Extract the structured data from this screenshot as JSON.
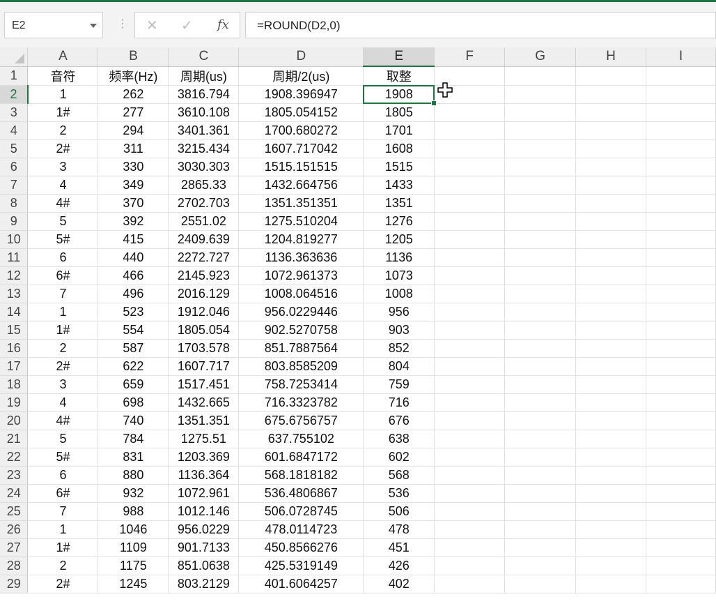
{
  "name_box": "E2",
  "formula": "=ROUND(D2,0)",
  "fx_label": "fx",
  "columns": [
    "A",
    "B",
    "C",
    "D",
    "E",
    "F",
    "G",
    "H",
    "I"
  ],
  "selected_cell": {
    "column": "E",
    "row": 2
  },
  "rows": [
    {
      "n": "1",
      "a": "音符",
      "b": "频率(Hz)",
      "c": "周期(us)",
      "d": "周期/2(us)",
      "e": "取整"
    },
    {
      "n": "2",
      "a": "1",
      "b": "262",
      "c": "3816.794",
      "d": "1908.396947",
      "e": "1908"
    },
    {
      "n": "3",
      "a": "1#",
      "b": "277",
      "c": "3610.108",
      "d": "1805.054152",
      "e": "1805"
    },
    {
      "n": "4",
      "a": "2",
      "b": "294",
      "c": "3401.361",
      "d": "1700.680272",
      "e": "1701"
    },
    {
      "n": "5",
      "a": "2#",
      "b": "311",
      "c": "3215.434",
      "d": "1607.717042",
      "e": "1608"
    },
    {
      "n": "6",
      "a": "3",
      "b": "330",
      "c": "3030.303",
      "d": "1515.151515",
      "e": "1515"
    },
    {
      "n": "7",
      "a": "4",
      "b": "349",
      "c": "2865.33",
      "d": "1432.664756",
      "e": "1433"
    },
    {
      "n": "8",
      "a": "4#",
      "b": "370",
      "c": "2702.703",
      "d": "1351.351351",
      "e": "1351"
    },
    {
      "n": "9",
      "a": "5",
      "b": "392",
      "c": "2551.02",
      "d": "1275.510204",
      "e": "1276"
    },
    {
      "n": "10",
      "a": "5#",
      "b": "415",
      "c": "2409.639",
      "d": "1204.819277",
      "e": "1205"
    },
    {
      "n": "11",
      "a": "6",
      "b": "440",
      "c": "2272.727",
      "d": "1136.363636",
      "e": "1136"
    },
    {
      "n": "12",
      "a": "6#",
      "b": "466",
      "c": "2145.923",
      "d": "1072.961373",
      "e": "1073"
    },
    {
      "n": "13",
      "a": "7",
      "b": "496",
      "c": "2016.129",
      "d": "1008.064516",
      "e": "1008"
    },
    {
      "n": "14",
      "a": "1",
      "b": "523",
      "c": "1912.046",
      "d": "956.0229446",
      "e": "956"
    },
    {
      "n": "15",
      "a": "1#",
      "b": "554",
      "c": "1805.054",
      "d": "902.5270758",
      "e": "903"
    },
    {
      "n": "16",
      "a": "2",
      "b": "587",
      "c": "1703.578",
      "d": "851.7887564",
      "e": "852"
    },
    {
      "n": "17",
      "a": "2#",
      "b": "622",
      "c": "1607.717",
      "d": "803.8585209",
      "e": "804"
    },
    {
      "n": "18",
      "a": "3",
      "b": "659",
      "c": "1517.451",
      "d": "758.7253414",
      "e": "759"
    },
    {
      "n": "19",
      "a": "4",
      "b": "698",
      "c": "1432.665",
      "d": "716.3323782",
      "e": "716"
    },
    {
      "n": "20",
      "a": "4#",
      "b": "740",
      "c": "1351.351",
      "d": "675.6756757",
      "e": "676"
    },
    {
      "n": "21",
      "a": "5",
      "b": "784",
      "c": "1275.51",
      "d": "637.755102",
      "e": "638"
    },
    {
      "n": "22",
      "a": "5#",
      "b": "831",
      "c": "1203.369",
      "d": "601.6847172",
      "e": "602"
    },
    {
      "n": "23",
      "a": "6",
      "b": "880",
      "c": "1136.364",
      "d": "568.1818182",
      "e": "568"
    },
    {
      "n": "24",
      "a": "6#",
      "b": "932",
      "c": "1072.961",
      "d": "536.4806867",
      "e": "536"
    },
    {
      "n": "25",
      "a": "7",
      "b": "988",
      "c": "1012.146",
      "d": "506.0728745",
      "e": "506"
    },
    {
      "n": "26",
      "a": "1",
      "b": "1046",
      "c": "956.0229",
      "d": "478.0114723",
      "e": "478"
    },
    {
      "n": "27",
      "a": "1#",
      "b": "1109",
      "c": "901.7133",
      "d": "450.8566276",
      "e": "451"
    },
    {
      "n": "28",
      "a": "2",
      "b": "1175",
      "c": "851.0638",
      "d": "425.5319149",
      "e": "426"
    },
    {
      "n": "29",
      "a": "2#",
      "b": "1245",
      "c": "803.2129",
      "d": "401.6064257",
      "e": "402"
    }
  ]
}
